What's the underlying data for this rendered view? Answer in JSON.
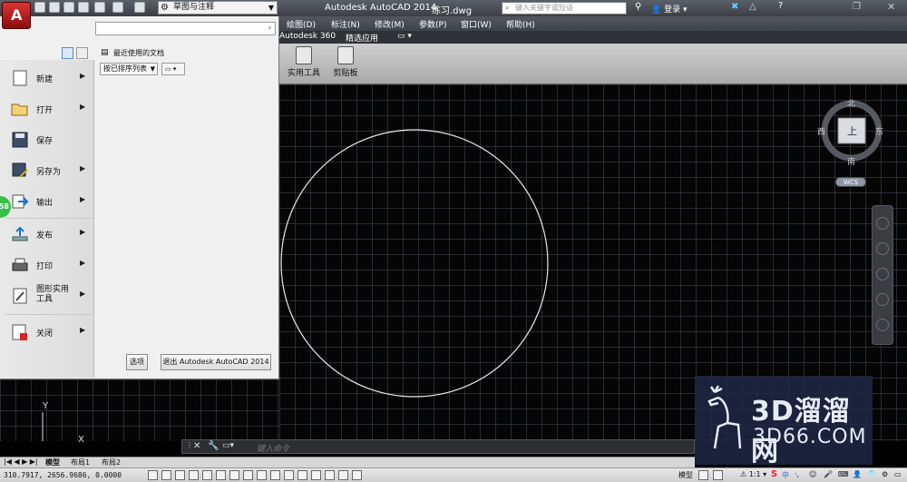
{
  "title_bar": {
    "workspace": "草图与注释",
    "app_title": "Autodesk AutoCAD 2014",
    "file_name": "练习.dwg",
    "search_placeholder": "键入关键字或短语",
    "login": "登录"
  },
  "menubar": {
    "items": [
      "绘图(D)",
      "标注(N)",
      "修改(M)",
      "参数(P)",
      "窗口(W)",
      "帮助(H)"
    ]
  },
  "ribbon_tabs": {
    "items": [
      "Autodesk 360",
      "精选应用"
    ]
  },
  "ribbon": {
    "utilities": "实用工具",
    "clipboard": "剪贴板"
  },
  "app_menu": {
    "recent_docs_title": "最近使用的文档",
    "sort_label": "按已排序列表",
    "items": [
      {
        "label": "新建",
        "icon": "new-file-icon"
      },
      {
        "label": "打开",
        "icon": "folder-open-icon"
      },
      {
        "label": "保存",
        "icon": "floppy-disk-icon"
      },
      {
        "label": "另存为",
        "icon": "save-as-icon"
      },
      {
        "label": "输出",
        "icon": "export-icon"
      },
      {
        "label": "发布",
        "icon": "publish-icon"
      },
      {
        "label": "打印",
        "icon": "printer-icon"
      },
      {
        "label": "图形实用\n工具",
        "icon": "drawing-utilities-icon"
      },
      {
        "label": "关闭",
        "icon": "close-file-icon"
      }
    ],
    "options_button": "选项",
    "exit_button": "退出 Autodesk AutoCAD 2014"
  },
  "green_badge": "58",
  "viewcube": {
    "north": "北",
    "south": "南",
    "east": "东",
    "west": "西",
    "top": "上",
    "wcs": "WCS"
  },
  "ucs": {
    "y": "Y",
    "x": "X"
  },
  "watermark": {
    "big": "3D溜溜网",
    "small": "3D66.COM"
  },
  "command_line": {
    "placeholder": "键入命令"
  },
  "layout_tabs": [
    "模型",
    "布局1",
    "布局2"
  ],
  "status_bar": {
    "coordinates": "310.7917,  2656.9686, 0.0000",
    "model_label": "模型",
    "scale": "1:1"
  },
  "colors": {
    "accent_red": "#c41e1e",
    "canvas_bg": "#050505",
    "grid": "#3a3f48"
  }
}
